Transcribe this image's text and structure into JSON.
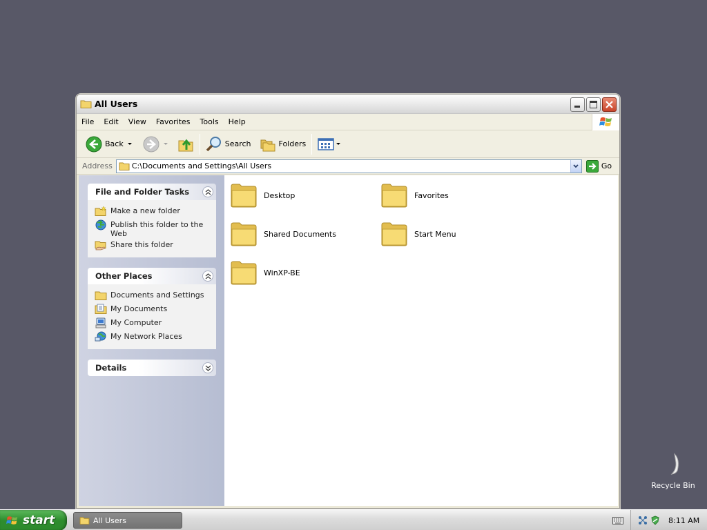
{
  "window": {
    "title": "All Users",
    "menu": [
      "File",
      "Edit",
      "View",
      "Favorites",
      "Tools",
      "Help"
    ],
    "toolbar": {
      "back_label": "Back",
      "search_label": "Search",
      "folders_label": "Folders"
    },
    "address": {
      "label": "Address",
      "value": "C:\\Documents and Settings\\All Users",
      "go_label": "Go"
    }
  },
  "taskpane": {
    "file_tasks": {
      "title": "File and Folder Tasks",
      "items": [
        {
          "label": "Make a new folder",
          "icon": "new-folder-icon"
        },
        {
          "label": "Publish this folder to the Web",
          "icon": "publish-web-icon"
        },
        {
          "label": "Share this folder",
          "icon": "share-folder-icon"
        }
      ]
    },
    "other_places": {
      "title": "Other Places",
      "items": [
        {
          "label": "Documents and Settings",
          "icon": "folder-icon"
        },
        {
          "label": "My Documents",
          "icon": "my-documents-icon"
        },
        {
          "label": "My Computer",
          "icon": "my-computer-icon"
        },
        {
          "label": "My Network Places",
          "icon": "network-places-icon"
        }
      ]
    },
    "details": {
      "title": "Details"
    }
  },
  "files": [
    {
      "name": "Desktop"
    },
    {
      "name": "Favorites"
    },
    {
      "name": "Shared Documents"
    },
    {
      "name": "Start Menu"
    },
    {
      "name": "WinXP-BE"
    }
  ],
  "desktop": {
    "recycle_bin_label": "Recycle Bin"
  },
  "taskbar": {
    "start_label": "start",
    "task_label": "All Users",
    "clock": "8:11 AM"
  },
  "colors": {
    "desktop_bg": "#585867",
    "start_green": "#2e8d2e",
    "taskpane_bg": "#c3c8da",
    "folder_yellow": "#f5d76a"
  }
}
